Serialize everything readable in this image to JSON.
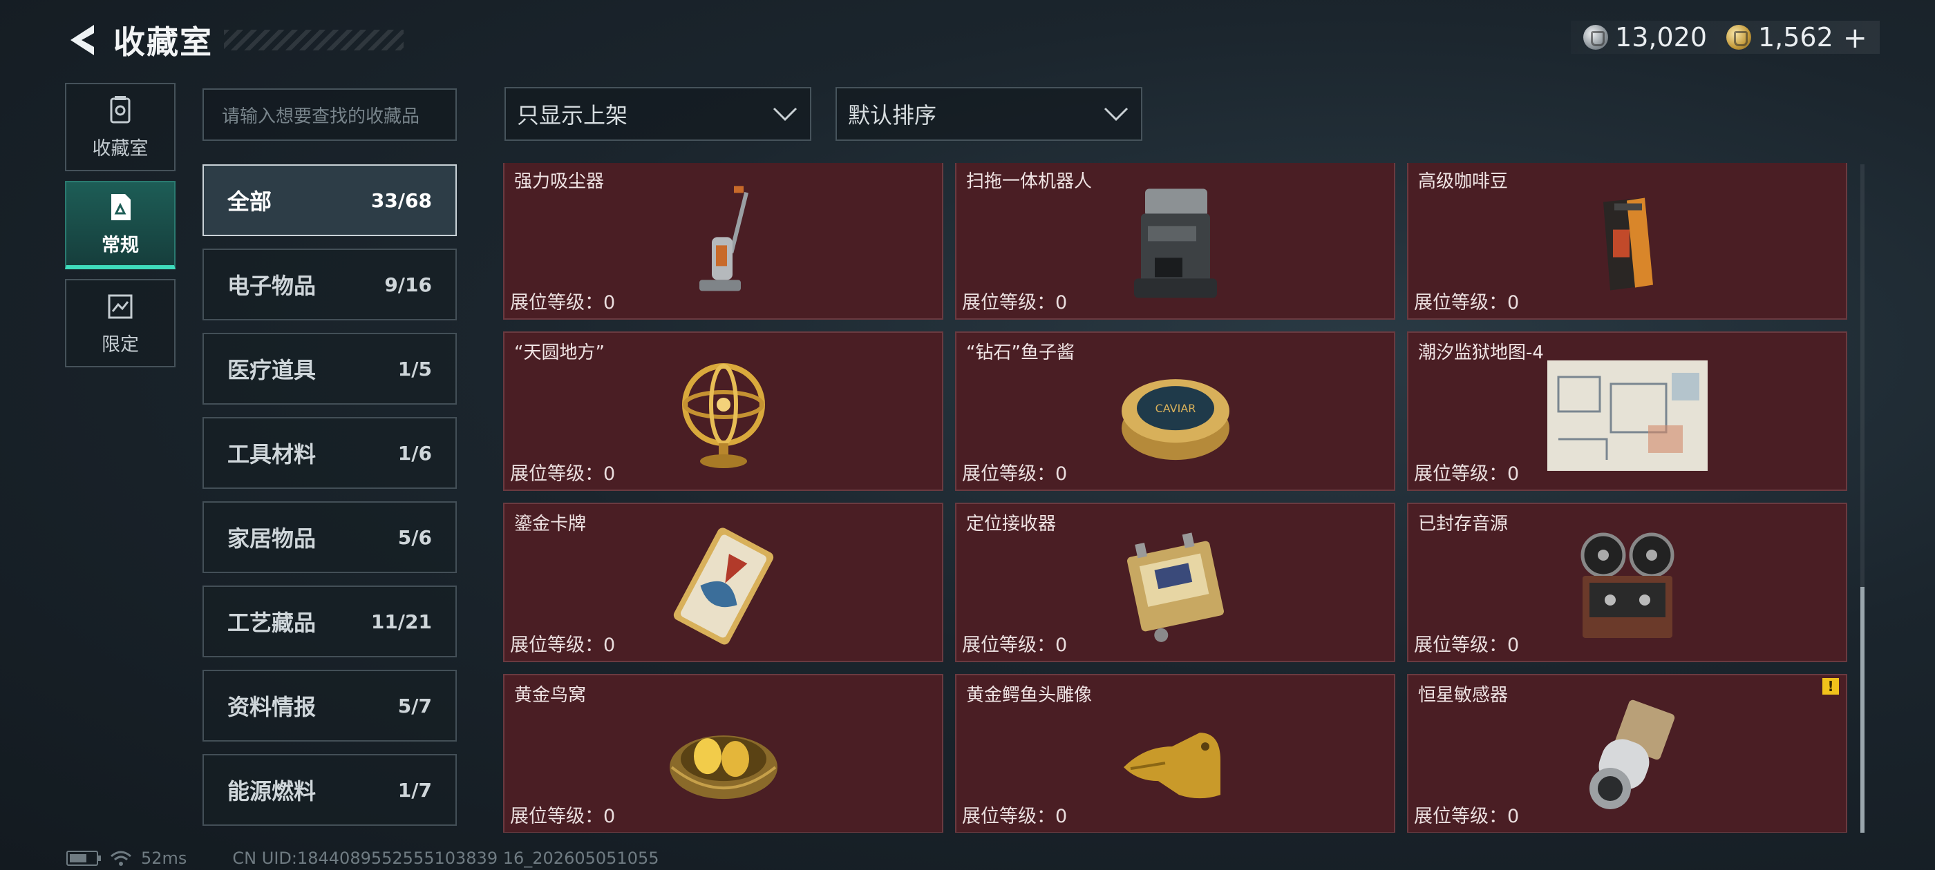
{
  "header": {
    "title": "收藏室",
    "back_icon": "back-arrow-icon"
  },
  "currency": [
    {
      "icon": "silver-coin-icon",
      "value": "13,020"
    },
    {
      "icon": "gold-coin-icon",
      "value": "1,562"
    }
  ],
  "currency_add_label": "+",
  "left_nav": [
    {
      "label": "收藏室",
      "icon": "collection-icon",
      "active": false
    },
    {
      "label": "常规",
      "icon": "regular-icon",
      "active": true
    },
    {
      "label": "限定",
      "icon": "limited-icon",
      "active": false
    }
  ],
  "search": {
    "placeholder": "请输入想要查找的收藏品"
  },
  "categories": [
    {
      "name": "全部",
      "count": "33/68",
      "active": true
    },
    {
      "name": "电子物品",
      "count": "9/16",
      "active": false
    },
    {
      "name": "医疗道具",
      "count": "1/5",
      "active": false
    },
    {
      "name": "工具材料",
      "count": "1/6",
      "active": false
    },
    {
      "name": "家居物品",
      "count": "5/6",
      "active": false
    },
    {
      "name": "工艺藏品",
      "count": "11/21",
      "active": false
    },
    {
      "name": "资料情报",
      "count": "5/7",
      "active": false
    },
    {
      "name": "能源燃料",
      "count": "1/7",
      "active": false
    }
  ],
  "filters": {
    "display_filter": "只显示上架",
    "sort_order": "默认排序"
  },
  "level_label": "展位等级：",
  "items": [
    {
      "name": "强力吸尘器",
      "level": "0",
      "icon": "vacuum-cleaner-icon"
    },
    {
      "name": "扫拖一体机器人",
      "level": "0",
      "icon": "robot-mop-icon"
    },
    {
      "name": "高级咖啡豆",
      "level": "0",
      "icon": "coffee-beans-icon"
    },
    {
      "name": "“天圆地方”",
      "level": "0",
      "icon": "armillary-sphere-icon"
    },
    {
      "name": "“钻石”鱼子酱",
      "level": "0",
      "icon": "caviar-tin-icon",
      "caption": "CAVIAR"
    },
    {
      "name": "潮汐监狱地图-4",
      "level": "0",
      "icon": "prison-map-icon"
    },
    {
      "name": "鎏金卡牌",
      "level": "0",
      "icon": "gilded-card-icon"
    },
    {
      "name": "定位接收器",
      "level": "0",
      "icon": "locator-receiver-icon"
    },
    {
      "name": "已封存音源",
      "level": "0",
      "icon": "reel-recorder-icon"
    },
    {
      "name": "黄金鸟窝",
      "level": "0",
      "icon": "golden-nest-icon"
    },
    {
      "name": "黄金鳄鱼头雕像",
      "level": "0",
      "icon": "gold-crocodile-icon"
    },
    {
      "name": "恒星敏感器",
      "level": "0",
      "icon": "star-sensor-icon",
      "warning": true
    }
  ],
  "footer": {
    "ping": "52ms",
    "uid": "CN UID:1844089552555103839 16_202605051055"
  },
  "colors": {
    "card_bg": "#4a1e24",
    "accent": "#3fdcbc",
    "warning": "#f1c21b"
  }
}
